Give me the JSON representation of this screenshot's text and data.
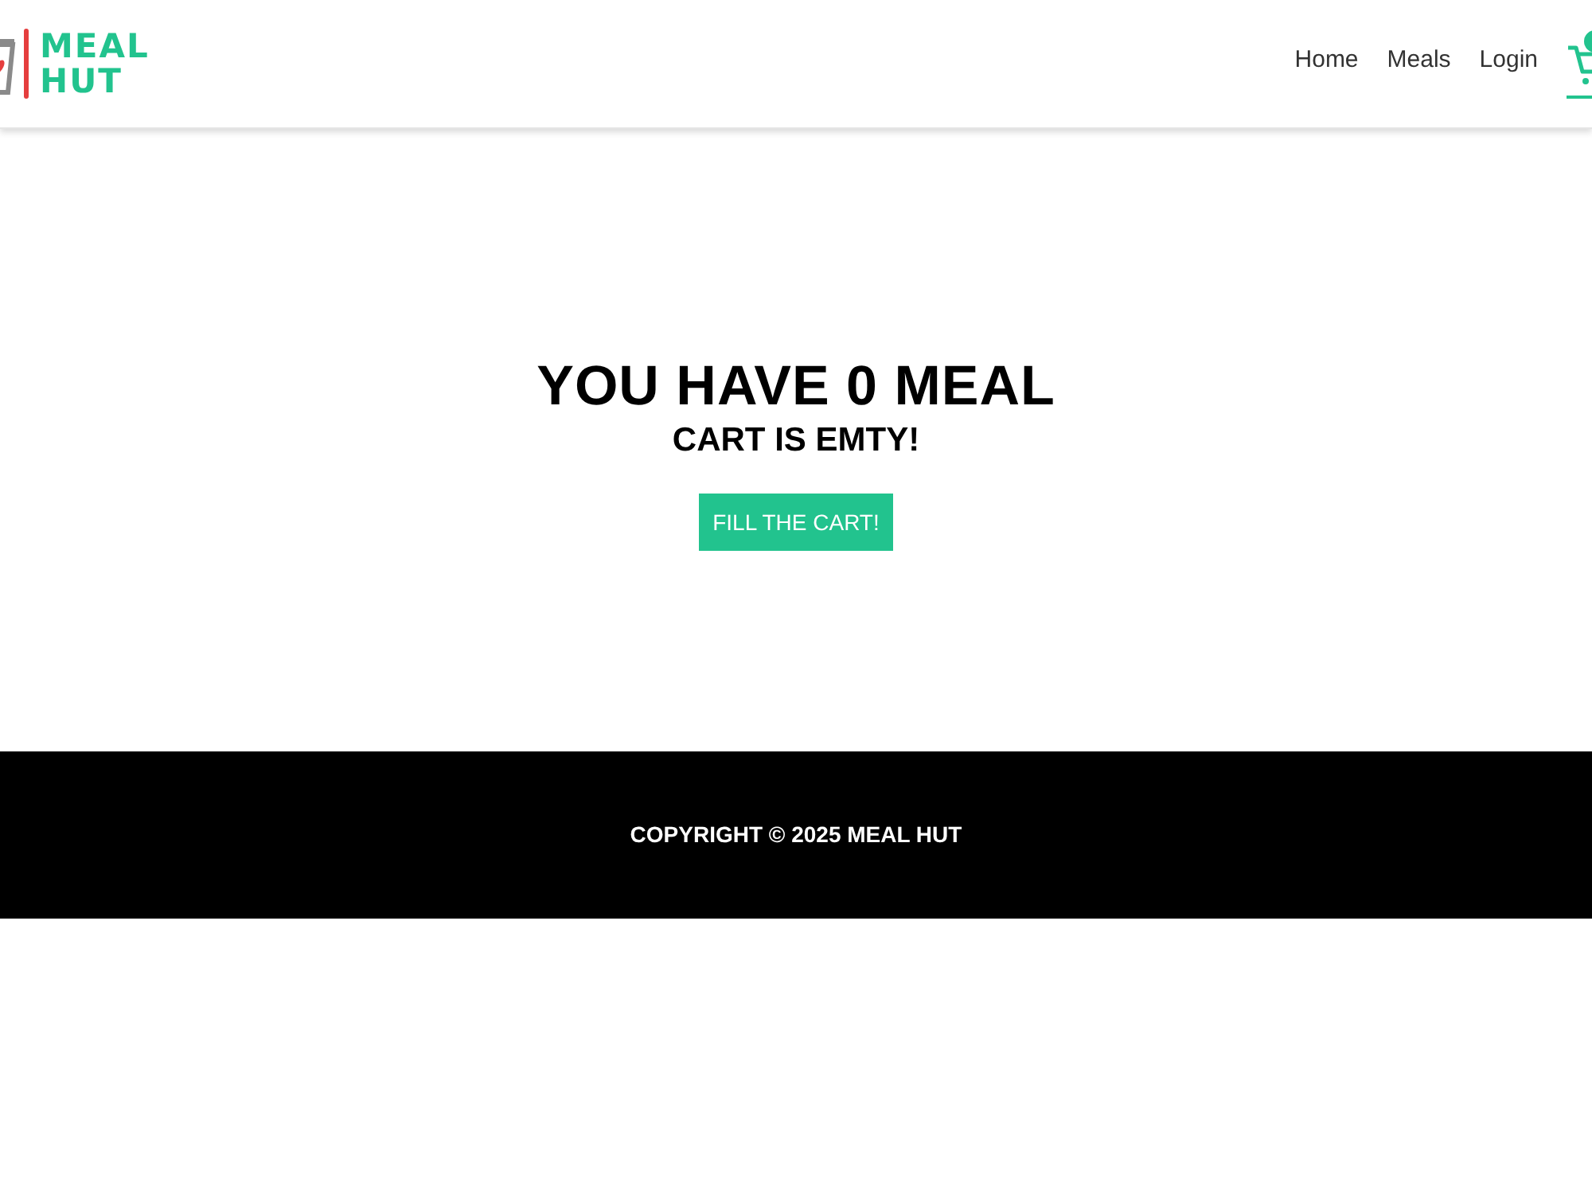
{
  "header": {
    "logo": {
      "line_1": "MEAL",
      "line_2": "HUT"
    },
    "nav": [
      {
        "label": "Home",
        "selected": false
      },
      {
        "label": "Meals",
        "selected": false
      },
      {
        "label": "Login",
        "selected": false
      }
    ],
    "cart": {
      "selected": true
    }
  },
  "main": {
    "title": "YOU HAVE 0 MEAL",
    "subtitle": "CART IS EMTY!",
    "button": "FILL THE CART!"
  },
  "footer": {
    "copyright": "COPYRIGHT © 2025 MEAL HUT"
  }
}
